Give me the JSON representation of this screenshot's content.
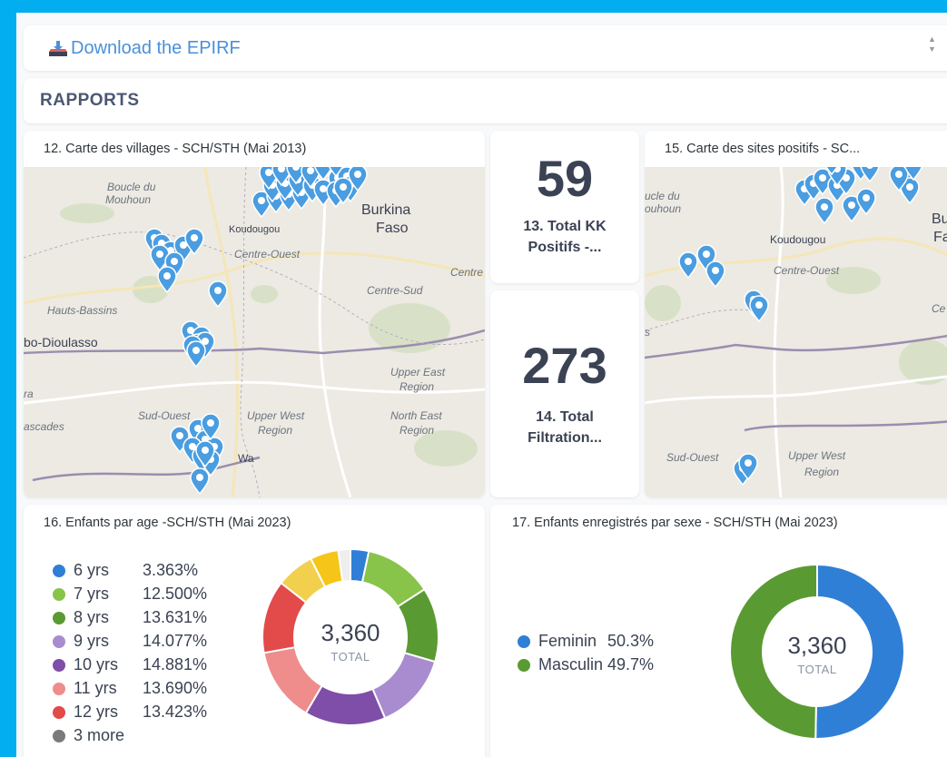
{
  "download": {
    "label": "Download the EPIRF"
  },
  "rapports": {
    "title": "RAPPORTS"
  },
  "cards": {
    "map1": {
      "title": "12. Carte des villages - SCH/STH (Mai 2013)",
      "places": [
        "Boucle du",
        "Mouhoun",
        "Koudougou",
        "Burkina",
        "Faso",
        "Centre-Ouest",
        "Centre",
        "Centre-Sud",
        "Hauts-Bassins",
        "bo-Dioulasso",
        "Upper East",
        "Region",
        "Sud-Ouest",
        "Upper West",
        "Region",
        "North East",
        "Region",
        "ra",
        "ascades",
        "Wa"
      ]
    },
    "kpi1": {
      "value": "59",
      "label": "13. Total KK Positifs -..."
    },
    "kpi2": {
      "value": "273",
      "label": "14. Total Filtration..."
    },
    "map2": {
      "title": "15. Carte des sites positifs - SC...",
      "places": [
        "ucle du",
        "ouhoun",
        "Koudougou",
        "Bur",
        "Fa",
        "Centre-Ouest",
        "Ce",
        "s",
        "Sud-Ouest",
        "Upper West",
        "Region"
      ]
    },
    "age": {
      "title": "16. Enfants par age -SCH/STH (Mai 2023)",
      "legend": [
        {
          "name": "6 yrs",
          "pct": "3.363%",
          "color": "#2f7fd6"
        },
        {
          "name": "7 yrs",
          "pct": "12.500%",
          "color": "#88c34a"
        },
        {
          "name": "8 yrs",
          "pct": "13.631%",
          "color": "#5a9a32"
        },
        {
          "name": "9 yrs",
          "pct": "14.077%",
          "color": "#a98ccf"
        },
        {
          "name": "10 yrs",
          "pct": "14.881%",
          "color": "#7e4ea8"
        },
        {
          "name": "11 yrs",
          "pct": "13.690%",
          "color": "#ef8c8c"
        },
        {
          "name": "12 yrs",
          "pct": "13.423%",
          "color": "#e34a4a"
        },
        {
          "name": "3 more",
          "pct": "",
          "color": "#7b7b7b"
        }
      ],
      "total": "3,360",
      "total_label": "TOTAL"
    },
    "sex": {
      "title": "17. Enfants enregistrés par sexe - SCH/STH (Mai 2023)",
      "legend": [
        {
          "name": "Feminin",
          "pct": "50.3%",
          "color": "#2f7fd6"
        },
        {
          "name": "Masculin",
          "pct": "49.7%",
          "color": "#5a9a32"
        }
      ],
      "total": "3,360",
      "total_label": "TOTAL"
    }
  },
  "chart_data": [
    {
      "type": "pie",
      "title": "16. Enfants par age -SCH/STH (Mai 2023)",
      "categories": [
        "6 yrs",
        "7 yrs",
        "8 yrs",
        "9 yrs",
        "10 yrs",
        "11 yrs",
        "12 yrs",
        "more-a",
        "more-b",
        "more-c"
      ],
      "values": [
        3.363,
        12.5,
        13.631,
        14.077,
        14.881,
        13.69,
        13.423,
        7.0,
        5.2,
        2.235
      ],
      "colors": [
        "#2f7fd6",
        "#88c34a",
        "#5a9a32",
        "#a98ccf",
        "#7e4ea8",
        "#ef8c8c",
        "#e34a4a",
        "#f2d04e",
        "#f5c518",
        "#eeeeee"
      ],
      "total": "3,360"
    },
    {
      "type": "pie",
      "title": "17. Enfants enregistrés par sexe - SCH/STH (Mai 2023)",
      "categories": [
        "Feminin",
        "Masculin"
      ],
      "values": [
        50.3,
        49.7
      ],
      "colors": [
        "#2f7fd6",
        "#5a9a32"
      ],
      "total": "3,360"
    }
  ]
}
